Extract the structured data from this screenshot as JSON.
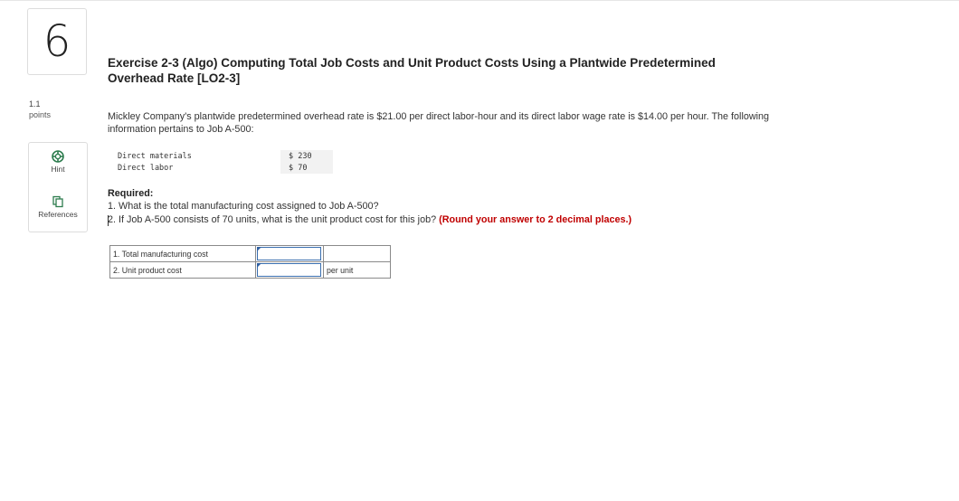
{
  "question": {
    "number": "6",
    "points_value": "1.1",
    "points_label": "points"
  },
  "tools": {
    "hint_label": "Hint",
    "references_label": "References"
  },
  "exercise": {
    "title": "Exercise 2-3 (Algo) Computing Total Job Costs and Unit Product Costs Using a Plantwide Predetermined Overhead Rate [LO2-3]",
    "intro": "Mickley Company's plantwide predetermined overhead rate is $21.00 per direct labor-hour and its direct labor wage rate is $14.00 per hour. The following information pertains to Job A-500:"
  },
  "job_data": [
    {
      "label": "Direct materials",
      "amount": "$ 230"
    },
    {
      "label": "Direct labor",
      "amount": "$ 70"
    }
  ],
  "required": {
    "heading": "Required:",
    "item1": "1. What is the total manufacturing cost assigned to Job A-500?",
    "item2": "2. If Job A-500 consists of 70 units, what is the unit product cost for this job?",
    "item2_note": "(Round your answer to 2 decimal places.)"
  },
  "answers": [
    {
      "label": "1. Total manufacturing cost",
      "value": "",
      "unit": ""
    },
    {
      "label": "2. Unit product cost",
      "value": "",
      "unit": "per unit"
    }
  ],
  "icons": {
    "hint": "lifebuoy-icon",
    "references": "copy-documents-icon"
  },
  "colors": {
    "note_red": "#c00000",
    "input_border": "#3a6fb0"
  }
}
